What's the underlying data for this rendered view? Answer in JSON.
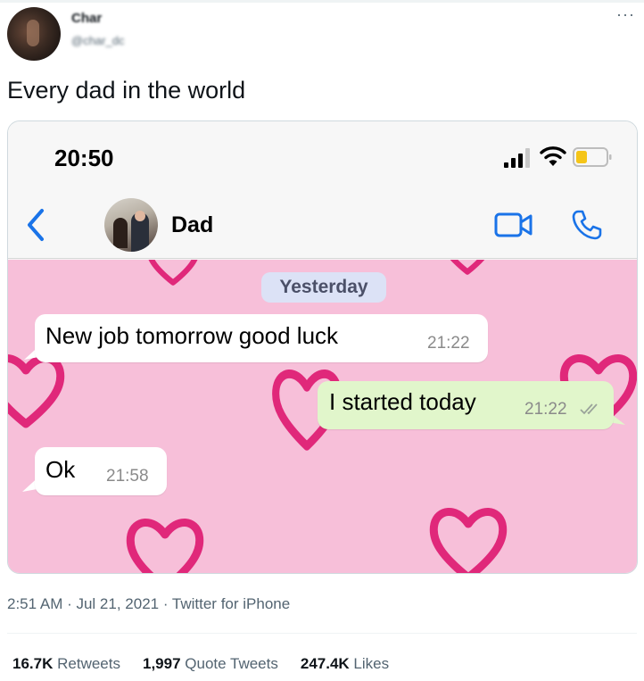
{
  "author": {
    "display_name": "Char",
    "handle": "@char_dc"
  },
  "tweet": {
    "text": "Every dad in the world",
    "timestamp": "2:51 AM · Jul 21, 2021 · Twitter for iPhone",
    "more_icon": "more-dots-icon"
  },
  "screenshot": {
    "status_time": "20:50",
    "contact_name": "Dad",
    "date_separator": "Yesterday",
    "messages": [
      {
        "direction": "incoming",
        "text": "New job tomorrow good luck",
        "time": "21:22"
      },
      {
        "direction": "outgoing",
        "text": "I started today",
        "time": "21:22",
        "status": "read-ticks-icon"
      },
      {
        "direction": "incoming",
        "text": "Ok",
        "time": "21:58"
      }
    ],
    "colors": {
      "chat_background": "#f7bfd9",
      "heart": "#e0287a",
      "incoming_bubble": "#ffffff",
      "outgoing_bubble": "#e1f6cb",
      "ios_blue": "#1a73e8",
      "date_pill": "#dce2f6"
    },
    "icons": [
      "back-chevron-icon",
      "video-call-icon",
      "phone-call-icon",
      "signal-icon",
      "wifi-icon",
      "battery-icon"
    ]
  },
  "stats": {
    "retweets_count": "16.7K",
    "retweets_label": "Retweets",
    "quotes_count": "1,997",
    "quotes_label": "Quote Tweets",
    "likes_count": "247.4K",
    "likes_label": "Likes"
  }
}
